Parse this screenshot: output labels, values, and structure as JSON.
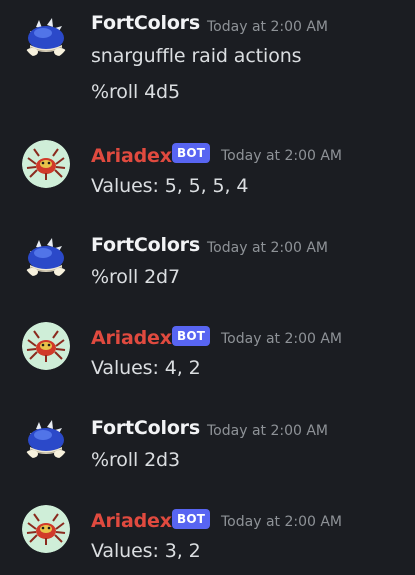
{
  "messages": [
    {
      "author": "FortColors",
      "timestamp": "Today at 2:00 AM",
      "lines": [
        "snarguffle raid actions",
        "%roll 4d5"
      ]
    },
    {
      "author": "Ariadex",
      "badge": "BOT",
      "timestamp": "Today at 2:00 AM",
      "lines": [
        "Values: 5, 5, 5, 4"
      ]
    },
    {
      "author": "FortColors",
      "timestamp": "Today at 2:00 AM",
      "lines": [
        "%roll 2d7"
      ]
    },
    {
      "author": "Ariadex",
      "badge": "BOT",
      "timestamp": "Today at 2:00 AM",
      "lines": [
        "Values: 4, 2"
      ]
    },
    {
      "author": "FortColors",
      "timestamp": "Today at 2:00 AM",
      "lines": [
        "%roll 2d3"
      ]
    },
    {
      "author": "Ariadex",
      "badge": "BOT",
      "timestamp": "Today at 2:00 AM",
      "lines": [
        "Values: 3, 2"
      ]
    }
  ],
  "icons": {
    "user_avatar": "blue-spiny-shell-icon",
    "bot_avatar": "ariados-spider-icon"
  },
  "colors": {
    "background": "#1b1d22",
    "user_name": "#f2f3f5",
    "bot_name": "#e04a3f",
    "bot_badge": "#5865f2",
    "timestamp": "#8e9297"
  }
}
